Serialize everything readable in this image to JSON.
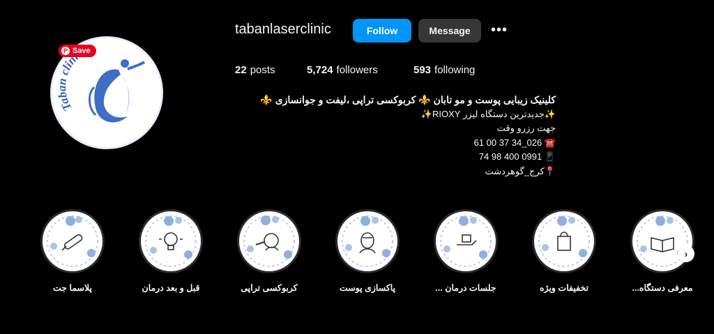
{
  "profile": {
    "username": "tabanlaserclinic",
    "follow_label": "Follow",
    "message_label": "Message",
    "more_label": "•••",
    "avatar_text": "Taban clinic",
    "pin_save_label": "Save"
  },
  "stats": {
    "posts_count": "22",
    "posts_label": "posts",
    "followers_count": "5,724",
    "followers_label": "followers",
    "following_count": "593",
    "following_label": "following"
  },
  "bio": {
    "line1": "کلینیک زیبایی پوست و مو تابان ⚜️ کربوکسی تراپی ،لیفت و جوانسازی ⚜️",
    "line2": "✨جدیدترین دستگاه لیزر RIOXY✨",
    "line3": "جهت رزرو وقت",
    "line4": "☎️ 026_34 37 00 61",
    "line5": "📱 0991 400 98 74",
    "line6": "📍کرج_گوهردشت"
  },
  "highlights": [
    {
      "label": "پلاسما جت",
      "icon": "plasma-pen-icon"
    },
    {
      "label": "قبل و بعد درمان",
      "icon": "lightbulb-icon"
    },
    {
      "label": "کربوکسی تراپی",
      "icon": "face-injection-icon"
    },
    {
      "label": "پاکسازی پوست",
      "icon": "face-mask-icon"
    },
    {
      "label": "جلسات درمان ...",
      "icon": "hand-bag-icon"
    },
    {
      "label": "تخفیفات ویژه",
      "icon": "shopping-bag-icon"
    },
    {
      "label": "معرفی دستگاه...",
      "icon": "open-book-icon"
    }
  ],
  "next_arrow": "›",
  "colors": {
    "background": "#000000",
    "follow_blue": "#0095f6",
    "message_gray": "#363636",
    "pinterest_red": "#e60023",
    "logo_blue": "#3f6fc4"
  }
}
